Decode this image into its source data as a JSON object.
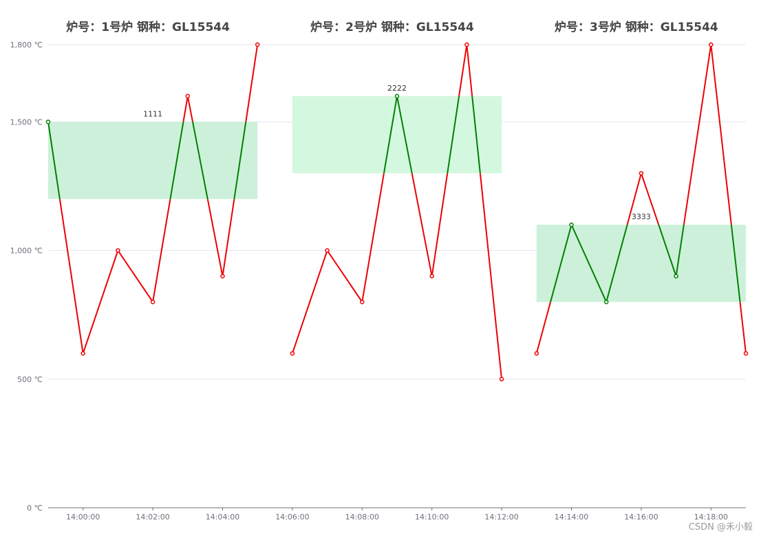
{
  "chart_data": {
    "type": "line",
    "unit_suffix": " ℃",
    "y_ticks": [
      0,
      500,
      1000,
      1500,
      1800
    ],
    "y_tick_labels": [
      "0 ℃",
      "500 ℃",
      "1,000 ℃",
      "1,500 ℃",
      "1,800 ℃"
    ],
    "ylim": [
      0,
      1800
    ],
    "x": [
      "13:59:00",
      "14:00:00",
      "14:01:00",
      "14:02:00",
      "14:03:00",
      "14:04:00",
      "14:05:00",
      "14:06:00",
      "14:07:00",
      "14:08:00",
      "14:09:00",
      "14:10:00",
      "14:11:00",
      "14:12:00",
      "14:13:00",
      "14:14:00",
      "14:15:00",
      "14:16:00",
      "14:17:00",
      "14:18:00",
      "14:19:00"
    ],
    "x_tick_labels": [
      "14:00:00",
      "14:02:00",
      "14:04:00",
      "14:06:00",
      "14:08:00",
      "14:10:00",
      "14:12:00",
      "14:14:00",
      "14:16:00",
      "14:18:00"
    ],
    "colors": {
      "in_range": "#008000",
      "out_of_range": "#ee0000",
      "band1": "#cdf0da",
      "band2": "#d4f7e0",
      "band3": "#cdf0da",
      "grid": "#e0e6f1"
    },
    "segments": [
      {
        "title": "炉号：1号炉      钢种：GL15544",
        "values": [
          1500,
          600,
          1000,
          800,
          1600,
          900,
          1800
        ],
        "band": [
          1200,
          1500
        ],
        "band_label": "1111"
      },
      {
        "title": "炉号：2号炉      钢种：GL15544",
        "values": [
          600,
          1000,
          800,
          1600,
          900,
          1800,
          500
        ],
        "band": [
          1300,
          1600
        ],
        "band_label": "2222"
      },
      {
        "title": "炉号：3号炉      钢种：GL15544",
        "values": [
          600,
          1100,
          800,
          1300,
          900,
          1800,
          600
        ],
        "band": [
          800,
          1100
        ],
        "band_label": "3333"
      }
    ]
  },
  "watermark": "CSDN @禾小毅"
}
